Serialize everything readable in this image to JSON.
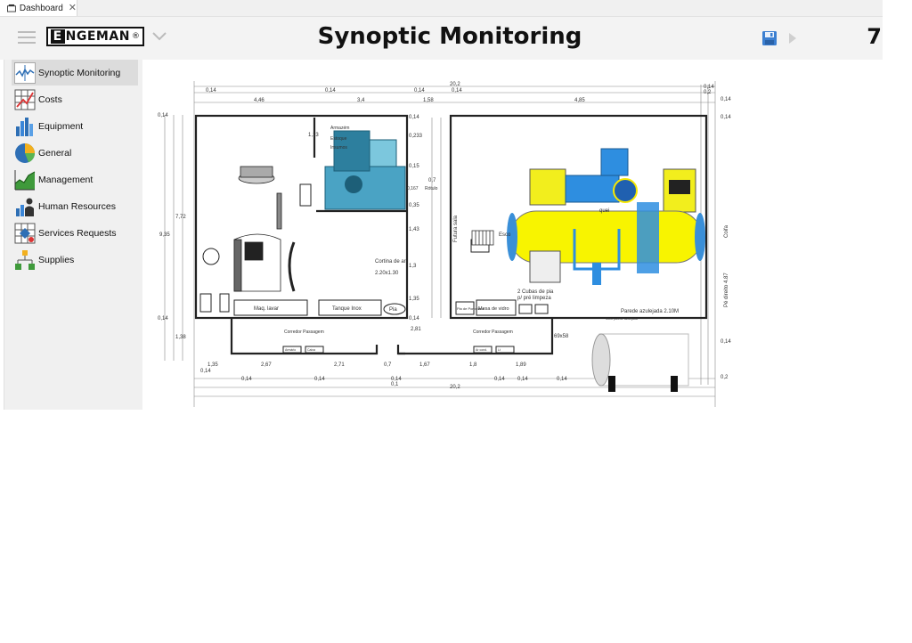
{
  "tab": {
    "label": "Dashboard",
    "close": "✕"
  },
  "header": {
    "logo": "ENGEMAN",
    "logo_e": "E",
    "logo_rest": "NGEMAN",
    "logo_mark": "®",
    "title": "Synoptic Monitoring",
    "count": "7"
  },
  "sidebar": {
    "items": [
      {
        "label": "Synoptic Monitoring",
        "icon": "synoptic-icon",
        "active": true
      },
      {
        "label": "Costs",
        "icon": "costs-grid-icon"
      },
      {
        "label": "Equipment",
        "icon": "equipment-bar-icon"
      },
      {
        "label": "General",
        "icon": "general-pie-icon"
      },
      {
        "label": "Management",
        "icon": "management-area-chart-icon"
      },
      {
        "label": "Human Resources",
        "icon": "human-resources-icon"
      },
      {
        "label": "Services Requests",
        "icon": "services-requests-icon"
      },
      {
        "label": "Supplies",
        "icon": "supplies-hierarchy-icon"
      }
    ]
  },
  "plan": {
    "dims": {
      "top_total": "20,2",
      "top_a": "0,14",
      "top_b": "4,46",
      "top_c": "0,14",
      "top_d": "3,4",
      "top_e": "0,14",
      "top_f": "1,58",
      "top_g": "0,14",
      "top_h": "4,85",
      "top_i": "0,14",
      "top_j": "0,2",
      "left_a": "0,14",
      "left_b": "7,72",
      "left_c": "9,35",
      "left_d": "0,14",
      "left_e": "1,38",
      "left_f": "0,14",
      "bottom_total": "20,2",
      "bot_a": "1,35",
      "bot_b": "2,67",
      "bot_c": "2,71",
      "bot_d": "0,7",
      "bot_e": "1,67",
      "bot_f": "1,8",
      "bot_g": "1,89",
      "bot_h": "0,14",
      "bot_i": "0,14",
      "bot_j": "0,14",
      "bot_k": "0,1",
      "bot_l": "0,14",
      "bot_m": "0,14",
      "bot_n": "0,14",
      "bot_o": "2,81",
      "mid_a": "0,14",
      "mid_b": "0,233",
      "mid_c": "0,15",
      "mid_d": "0,7",
      "mid_e": "0,35",
      "mid_f": "1,43",
      "mid_g": "1,3",
      "mid_h": "1,35",
      "mid_i": "0,14",
      "mid_j": "1,13",
      "right_a": "0,14",
      "right_b": "0,14",
      "right_c": "0,14",
      "right_d": "0,2"
    },
    "labels": {
      "maq_lavar": "Maq. lavar",
      "tanque_inox": "Tanque Inox",
      "pia": "Pia",
      "cortina": "Cortina de ar",
      "cortina_dim": "2.20x1.30",
      "pia_porcelana": "Pia de Porcelana",
      "mesa_vidro": "Mesa de vidro",
      "cubas_1": "2 Cubas de pia",
      "cubas_2": "p/ pré limpeza",
      "parede": "Parede azulejada 2.10M",
      "pe_direito": "Pé direito 4.87",
      "coifa": "Coifa",
      "futura_sala": "Futura sala",
      "esco": "Esco",
      "quei": "quei",
      "corredor_1": "Corredor Passagem",
      "corredor_2": "Corredor Passagem",
      "dim_69": "69x58",
      "muro": "Muro parede azulejada",
      "armario": "Armário",
      "caixa": "Caixa",
      "ar_cond": "Ar cond.",
      "lt": "Lt",
      "n0167": "0,167",
      "rotulo": "Rótulo",
      "mancha_1": "Armazém",
      "mancha_2": "Estoque",
      "mancha_3": "Insumos"
    }
  }
}
